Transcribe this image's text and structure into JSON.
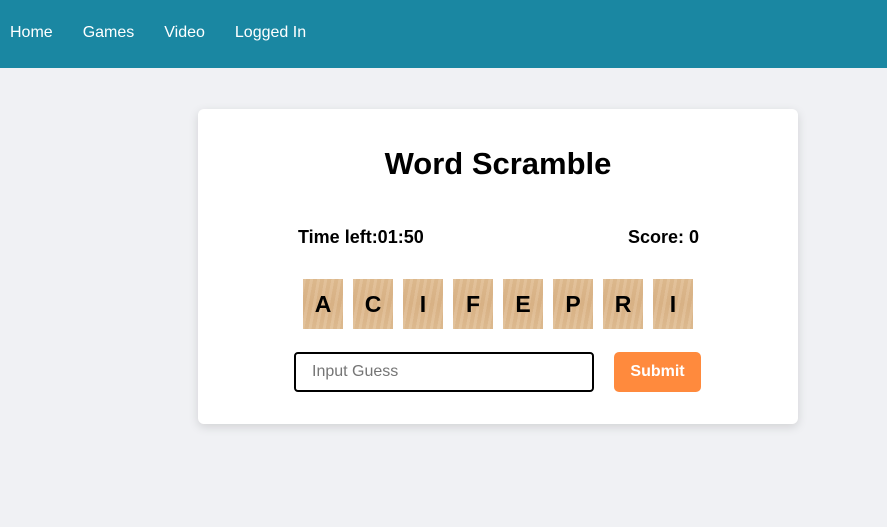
{
  "nav": {
    "items": [
      {
        "label": "Home"
      },
      {
        "label": "Games"
      },
      {
        "label": "Video"
      },
      {
        "label": "Logged In"
      }
    ]
  },
  "game": {
    "title": "Word Scramble",
    "time_left": "Time left:01:50",
    "score": "Score: 0",
    "letters": [
      "A",
      "C",
      "I",
      "F",
      "E",
      "P",
      "R",
      "I"
    ],
    "input": {
      "placeholder": "Input Guess",
      "value": ""
    },
    "submit_label": "Submit"
  },
  "colors": {
    "navbar": "#1a87a2",
    "page_background": "#f0f1f4",
    "submit_button": "#ff8a3d",
    "tile": "#dcb68a"
  }
}
